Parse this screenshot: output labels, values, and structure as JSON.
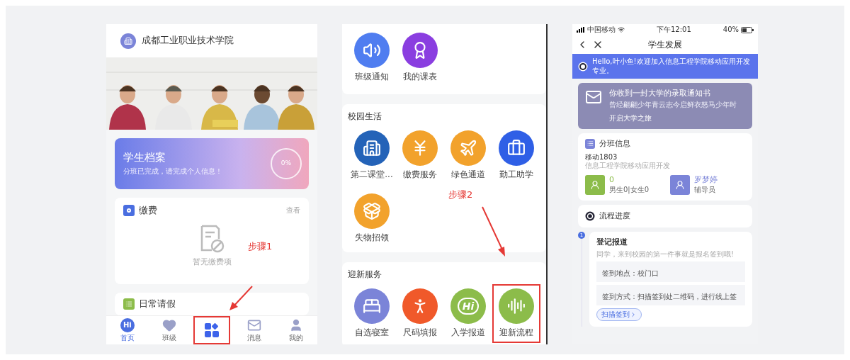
{
  "screen_home": {
    "school_name": "成都工业职业技术学院",
    "profile_card": {
      "title": "学生档案",
      "subtitle": "分班已完成，请完成个人信息！",
      "progress_text": "0%"
    },
    "fee_card": {
      "title": "缴费",
      "link": "查看",
      "empty_text": "暂无缴费项"
    },
    "leave_card": {
      "title": "日常请假"
    },
    "tabs": [
      {
        "icon_text": "Hi",
        "label": "首页",
        "selected": true,
        "highlighted": false
      },
      {
        "label": "班级",
        "selected": false,
        "highlighted": false
      },
      {
        "selected": false,
        "highlighted": true
      },
      {
        "label": "消息",
        "selected": false,
        "highlighted": false
      },
      {
        "label": "我的",
        "selected": false,
        "highlighted": false
      }
    ],
    "annotation": "步骤1"
  },
  "screen_services": {
    "top_items": [
      {
        "label": "班级通知",
        "color": "#4f7df0"
      },
      {
        "label": "我的课表",
        "color": "#8a3ee0"
      }
    ],
    "sections": [
      {
        "title": "校园生活",
        "items": [
          {
            "label": "第二课堂...",
            "color": "#2463b8",
            "highlighted": false
          },
          {
            "label": "缴费服务",
            "color": "#f2a22c",
            "highlighted": false
          },
          {
            "label": "绿色通道",
            "color": "#f2a22c",
            "highlighted": false
          },
          {
            "label": "勤工助学",
            "color": "#2f5fe6",
            "highlighted": false
          },
          {
            "label": "失物招领",
            "color": "#f2a22c",
            "highlighted": false
          }
        ]
      },
      {
        "title": "迎新服务",
        "items": [
          {
            "label": "自选寝室",
            "color": "#7b84d8",
            "highlighted": false
          },
          {
            "label": "尺码填报",
            "color": "#f0592a",
            "highlighted": false
          },
          {
            "label": "入学报道",
            "color": "#8cbc4a",
            "icon_text": "Hi",
            "highlighted": false
          },
          {
            "label": "迎新流程",
            "color": "#8cbc4a",
            "highlighted": true
          }
        ]
      }
    ],
    "annotation": "步骤2"
  },
  "screen_development": {
    "status_bar": {
      "carrier": "中国移动",
      "time": "下午12:01",
      "battery": "40%"
    },
    "title": "学生发展",
    "banner": "Hello,叶小鱼!欢迎加入信息工程学院移动应用开发专业。",
    "letter_card": {
      "title": "你收到一封大学的录取通知书",
      "subtitle": "曾经翩翩少年青云志今启鲜衣怒马少年时",
      "link": "开启大学之旅"
    },
    "class_card": {
      "title": "分班信息",
      "class_name": "移动1803",
      "department": "信息工程学院移动应用开发",
      "stats": [
        {
          "value": "0",
          "label": "男生0|女生0",
          "color": "#8cbc4a"
        },
        {
          "value": "罗梦婷",
          "label": "辅导员",
          "color": "#7b84d8"
        }
      ]
    },
    "progress_card": {
      "title": "流程进度"
    },
    "steps": [
      {
        "number": "1",
        "title": "登记报道",
        "description": "同学，来到校园的第一件事就是报名签到哦!",
        "rows": [
          "签到地点：校门口",
          "签到方式：扫描签到处二维码，进行线上签"
        ],
        "button": "扫描签到"
      }
    ]
  }
}
